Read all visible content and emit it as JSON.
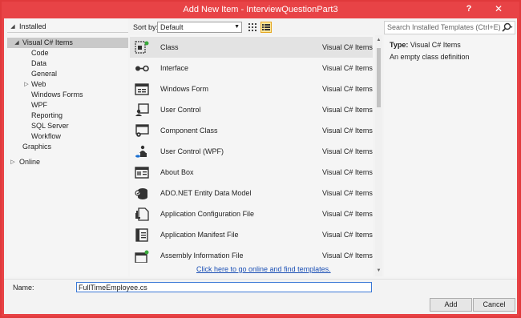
{
  "window": {
    "title": "Add New Item - InterviewQuestionPart3",
    "help_label": "?",
    "close_label": "✕"
  },
  "tree": {
    "installed": "Installed",
    "visual_cs": "Visual C# Items",
    "children": [
      "Code",
      "Data",
      "General",
      "Web",
      "Windows Forms",
      "WPF",
      "Reporting",
      "SQL Server",
      "Workflow"
    ],
    "graphics": "Graphics",
    "online": "Online"
  },
  "sort": {
    "label": "Sort by:",
    "value": "Default"
  },
  "templates": [
    {
      "name": "Class",
      "category": "Visual C# Items",
      "icon": "class-icon"
    },
    {
      "name": "Interface",
      "category": "Visual C# Items",
      "icon": "interface-icon"
    },
    {
      "name": "Windows Form",
      "category": "Visual C# Items",
      "icon": "windows-form-icon"
    },
    {
      "name": "User Control",
      "category": "Visual C# Items",
      "icon": "user-control-icon"
    },
    {
      "name": "Component Class",
      "category": "Visual C# Items",
      "icon": "component-class-icon"
    },
    {
      "name": "User Control (WPF)",
      "category": "Visual C# Items",
      "icon": "user-control-wpf-icon"
    },
    {
      "name": "About Box",
      "category": "Visual C# Items",
      "icon": "about-box-icon"
    },
    {
      "name": "ADO.NET Entity Data Model",
      "category": "Visual C# Items",
      "icon": "entity-data-model-icon"
    },
    {
      "name": "Application Configuration File",
      "category": "Visual C# Items",
      "icon": "config-file-icon"
    },
    {
      "name": "Application Manifest File",
      "category": "Visual C# Items",
      "icon": "manifest-file-icon"
    },
    {
      "name": "Assembly Information File",
      "category": "Visual C# Items",
      "icon": "assembly-info-icon"
    }
  ],
  "online_link": "Click here to go online and find templates.",
  "search": {
    "placeholder": "Search Installed Templates (Ctrl+E)"
  },
  "details": {
    "type_label": "Type:",
    "type_value": "Visual C# Items",
    "description": "An empty class definition"
  },
  "name_field": {
    "label": "Name:",
    "value": "FullTimeEmployee.cs"
  },
  "buttons": {
    "add": "Add",
    "cancel": "Cancel"
  },
  "colors": {
    "title_bar": "#e84346",
    "selection": "#c9c9c9",
    "link": "#1a4fb5"
  }
}
